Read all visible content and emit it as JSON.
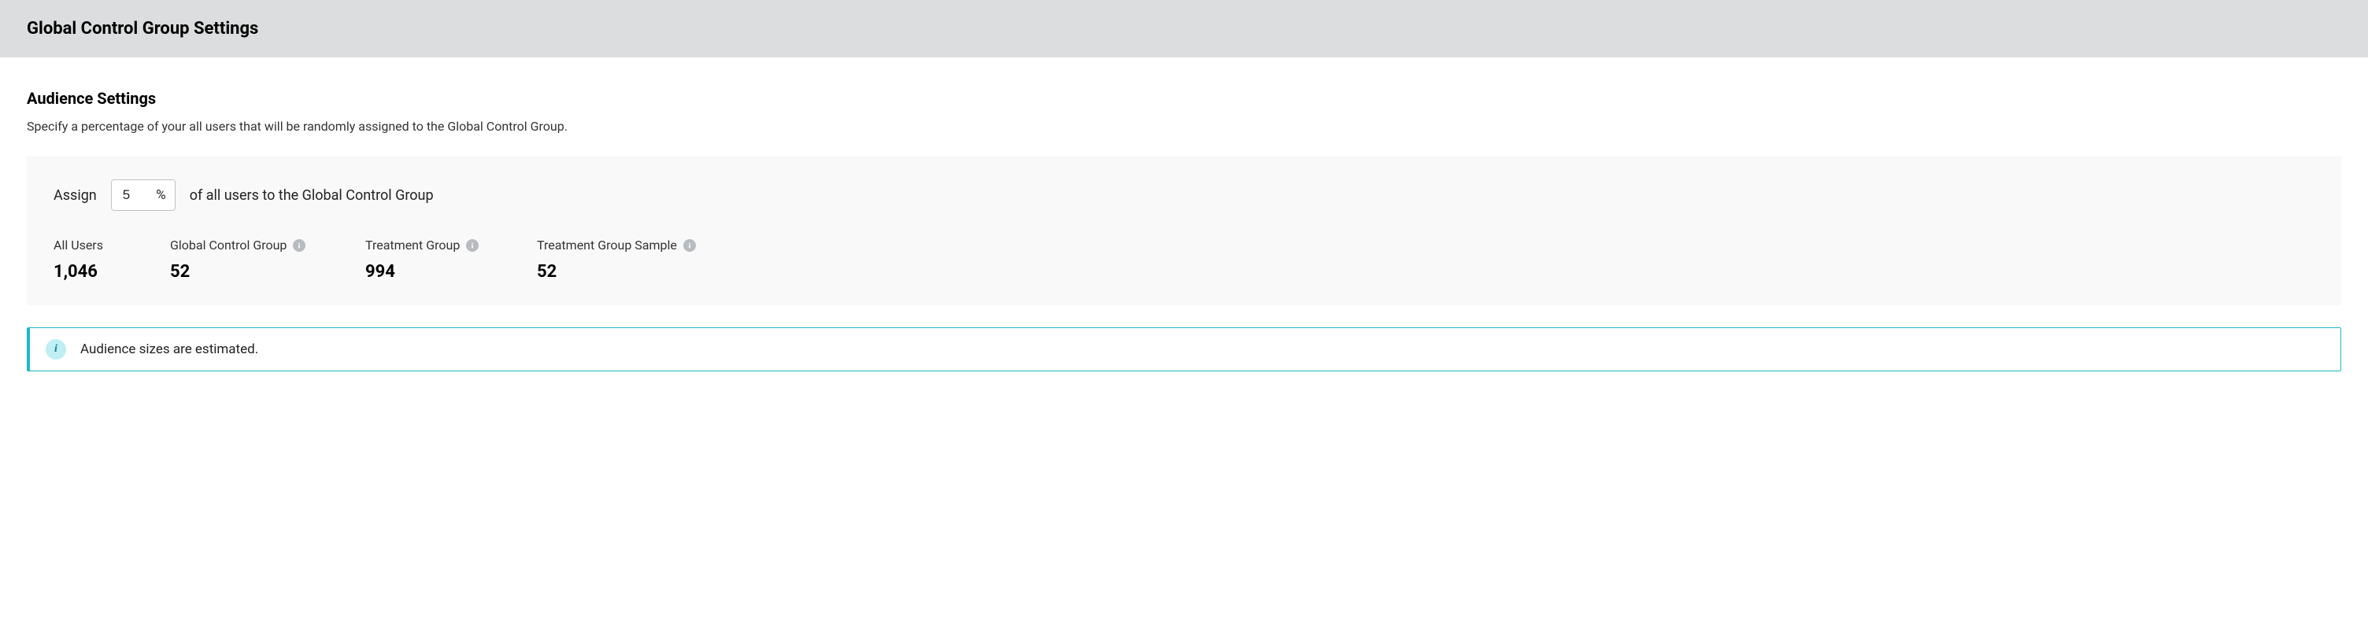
{
  "header": {
    "title": "Global Control Group Settings"
  },
  "audience": {
    "section_title": "Audience Settings",
    "section_desc": "Specify a percentage of your all users that will be randomly assigned to the Global Control Group.",
    "assign_prefix": "Assign",
    "assign_suffix": "of all users to the Global Control Group",
    "percent_value": "5",
    "percent_symbol": "%",
    "stats": {
      "all_users": {
        "label": "All Users",
        "value": "1,046"
      },
      "global_control": {
        "label": "Global Control Group",
        "value": "52"
      },
      "treatment": {
        "label": "Treatment Group",
        "value": "994"
      },
      "treatment_sample": {
        "label": "Treatment Group Sample",
        "value": "52"
      }
    }
  },
  "alert": {
    "text": "Audience sizes are estimated."
  }
}
